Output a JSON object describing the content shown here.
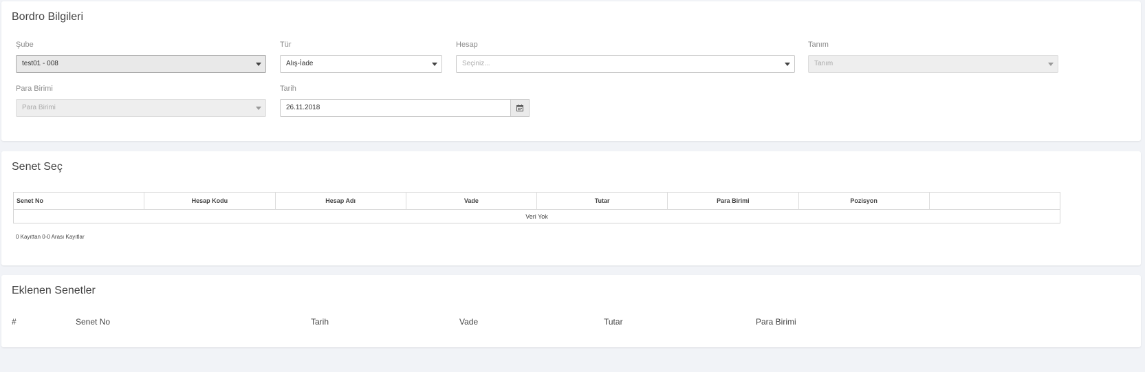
{
  "bordro": {
    "title": "Bordro Bilgileri",
    "sube": {
      "label": "Şube",
      "value": "test01 - 008"
    },
    "tur": {
      "label": "Tür",
      "value": "Alış-İade"
    },
    "hesap": {
      "label": "Hesap",
      "placeholder": "Seçiniz..."
    },
    "tanim": {
      "label": "Tanım",
      "placeholder": "Tanım"
    },
    "para_birimi": {
      "label": "Para Birimi",
      "placeholder": "Para Birimi"
    },
    "tarih": {
      "label": "Tarih",
      "value": "26.11.2018",
      "icon": "calendar-icon"
    }
  },
  "senet_sec": {
    "title": "Senet Seç",
    "columns": [
      "Senet No",
      "Hesap Kodu",
      "Hesap Adı",
      "Vade",
      "Tutar",
      "Para Birimi",
      "Pozisyon",
      ""
    ],
    "empty_text": "Veri Yok",
    "info": "0 Kayıttan 0-0 Arası Kayıtlar"
  },
  "eklenen": {
    "title": "Eklenen Senetler",
    "columns": [
      "#",
      "Senet No",
      "Tarih",
      "Vade",
      "Tutar",
      "Para Birimi"
    ]
  }
}
